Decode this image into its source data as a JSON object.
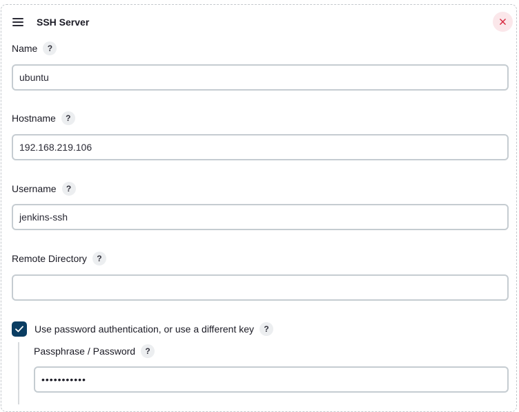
{
  "header": {
    "title": "SSH Server",
    "close_label": "×"
  },
  "fields": {
    "name": {
      "label": "Name",
      "value": "ubuntu"
    },
    "hostname": {
      "label": "Hostname",
      "value": "192.168.219.106"
    },
    "username": {
      "label": "Username",
      "value": "jenkins-ssh"
    },
    "remote_directory": {
      "label": "Remote Directory",
      "value": ""
    },
    "passphrase": {
      "label": "Passphrase / Password",
      "value": "•••••••••••"
    }
  },
  "password_auth": {
    "label": "Use password authentication, or use a different key",
    "checked": true
  },
  "help_glyph": "?",
  "icons": {
    "drag": "drag-handle-icon",
    "close": "close-icon",
    "help": "help-icon",
    "check": "checkmark-icon"
  },
  "colors": {
    "checkbox_fill": "#0a3d62",
    "close_bg": "#fbe7ea",
    "close_x": "#d6263d",
    "input_border": "#c5ccd1",
    "panel_border": "#c3c7cc"
  }
}
